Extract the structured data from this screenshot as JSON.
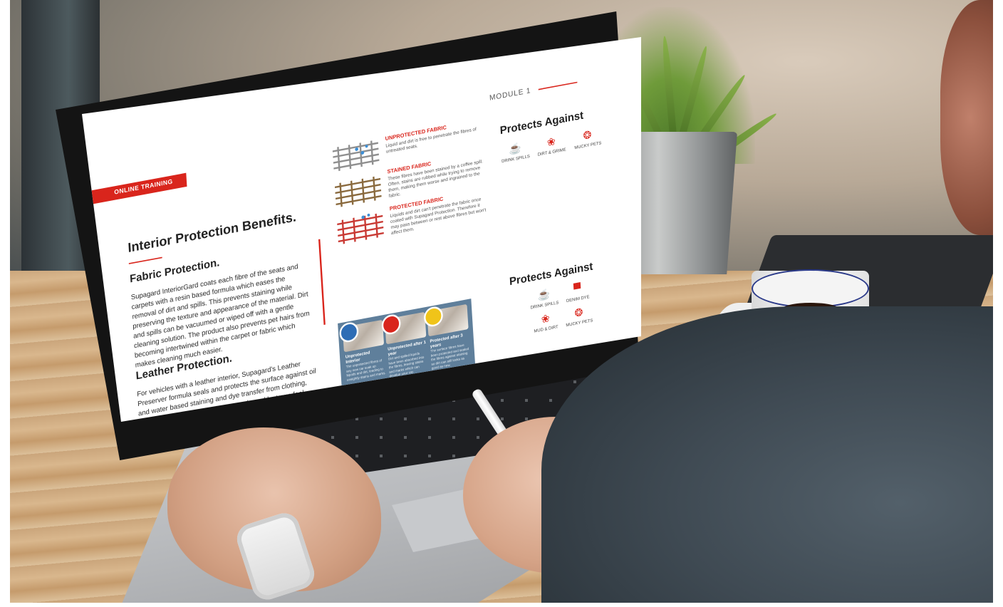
{
  "screen": {
    "module_tag": "MODULE 1",
    "badge": "ONLINE TRAINING",
    "title": "Interior Protection Benefits.",
    "fabric": {
      "heading": "Fabric Protection.",
      "body": "Supagard InteriorGard coats each fibre of the seats and carpets with a resin based formula which eases the removal of dirt and spills. This prevents staining while preserving the texture and appearance of the material. Dirt and spills can be vacuumed or wiped off with a gentle cleaning solution. The product also prevents pet hairs from becoming intertwined within the carpet or fabric which makes cleaning much easier."
    },
    "leather": {
      "heading": "Leather Protection.",
      "body": "For vehicles with a leather interior, Supagard's Leather Preserver formula seals and protects the surface against oil and water based staining and dye transfer from clothing, without damaging the leather's supple and lustrous feel."
    },
    "fabric_states": [
      {
        "title": "UNPROTECTED FABRIC",
        "text": "Liquid and dirt is free to penetrate the fibres of untreated seats.",
        "color": "#8f8f8f"
      },
      {
        "title": "STAINED FABRIC",
        "text": "These fibres have been stained by a coffee spill. Often, stains are rubbed while trying to remove them, making them worse and ingrained to the fabric.",
        "color": "#8a6a3e"
      },
      {
        "title": "PROTECTED FABRIC",
        "text": "Liquids and dirt can't penetrate the fabric once coated with Supagard Protection. Therefore it may pass between or rest above fibres but won't affect them.",
        "color": "#c93a34"
      }
    ],
    "protects_fabric": {
      "heading": "Protects Against",
      "items": [
        {
          "icon": "drink-spill-icon",
          "glyph": "☕",
          "label": "DRINK SPILLS"
        },
        {
          "icon": "dirt-grime-icon",
          "glyph": "❀",
          "label": "DIRT & GRIME"
        },
        {
          "icon": "paw-icon",
          "glyph": "❂",
          "label": "MUCKY PETS"
        }
      ]
    },
    "protects_leather": {
      "heading": "Protects Against",
      "items": [
        {
          "icon": "drink-spill-icon",
          "glyph": "☕",
          "label": "DRINK SPILLS"
        },
        {
          "icon": "jeans-icon",
          "glyph": "▀",
          "label": "DENIM DYE"
        },
        {
          "icon": "mud-icon",
          "glyph": "❀",
          "label": "MUD & DIRT"
        },
        {
          "icon": "paw-icon",
          "glyph": "❂",
          "label": "MUCKY PETS"
        }
      ]
    },
    "leather_panel": [
      {
        "title": "Unprotected Interior",
        "text": "The unprotected fibres of any new car soak up liquids and dirt, leading to unsightly stains and marks.",
        "badge_color": "#2e6db5"
      },
      {
        "title": "Unprotected after 1 year",
        "text": "Dirt and spilled liquids have been absorbed into the fibres, leaving stains and marks which can devalue your car.",
        "badge_color": "#d9251c"
      },
      {
        "title": "Protected after 3 years",
        "text": "The surface fibres have been protected and sealed the fibres against staining so dirt can still looks as good as new.",
        "badge_color": "#f0c419"
      }
    ],
    "accent_color": "#d9251c"
  }
}
